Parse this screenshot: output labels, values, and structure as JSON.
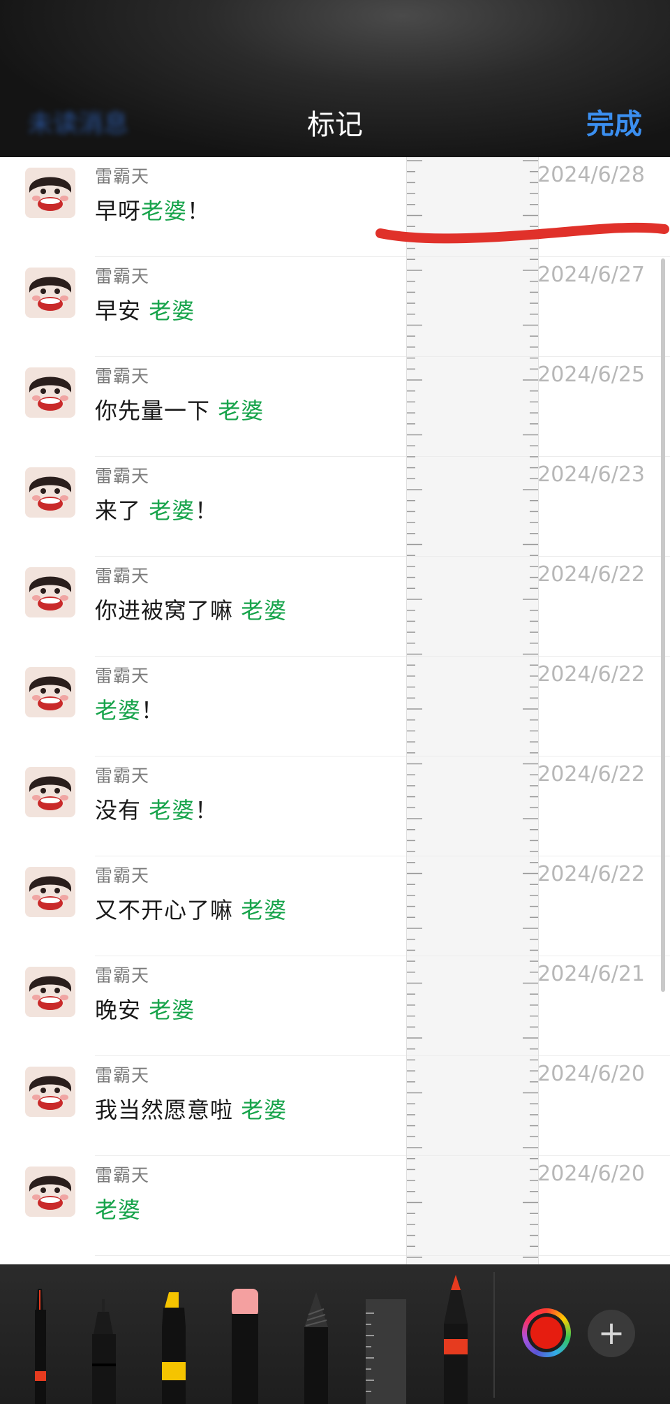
{
  "navbar": {
    "back_label": "未读消息",
    "title": "标记",
    "done_label": "完成"
  },
  "messages": [
    {
      "name": "雷霸天",
      "text": "早呀",
      "keyword": "老婆",
      "suffix": "！",
      "date": "2024/6/28"
    },
    {
      "name": "雷霸天",
      "text": "早安 ",
      "keyword": "老婆",
      "suffix": "",
      "date": "2024/6/27"
    },
    {
      "name": "雷霸天",
      "text": "你先量一下 ",
      "keyword": "老婆",
      "suffix": "",
      "date": "2024/6/25"
    },
    {
      "name": "雷霸天",
      "text": "来了 ",
      "keyword": "老婆",
      "suffix": "！",
      "date": "2024/6/23"
    },
    {
      "name": "雷霸天",
      "text": "你进被窝了嘛 ",
      "keyword": "老婆",
      "suffix": "",
      "date": "2024/6/22"
    },
    {
      "name": "雷霸天",
      "text": "",
      "keyword": "老婆",
      "suffix": "！",
      "date": "2024/6/22"
    },
    {
      "name": "雷霸天",
      "text": "没有 ",
      "keyword": "老婆",
      "suffix": "！",
      "date": "2024/6/22"
    },
    {
      "name": "雷霸天",
      "text": "又不开心了嘛 ",
      "keyword": "老婆",
      "suffix": "",
      "date": "2024/6/22"
    },
    {
      "name": "雷霸天",
      "text": "晚安 ",
      "keyword": "老婆",
      "suffix": "",
      "date": "2024/6/21"
    },
    {
      "name": "雷霸天",
      "text": "我当然愿意啦 ",
      "keyword": "老婆",
      "suffix": "",
      "date": "2024/6/20"
    },
    {
      "name": "雷霸天",
      "text": "",
      "keyword": "老婆",
      "suffix": "",
      "date": "2024/6/20"
    }
  ],
  "markup_tools": [
    "pen-tool",
    "fineliner-tool",
    "highlighter-tool",
    "eraser-tool",
    "lasso-tool",
    "ruler-tool",
    "crayon-tool"
  ],
  "colors": {
    "highlight": "#16a34a",
    "done": "#3b8ff0",
    "pen_stroke": "#e0312a",
    "selected_color": "#e61d10"
  },
  "add_button_label": "+"
}
